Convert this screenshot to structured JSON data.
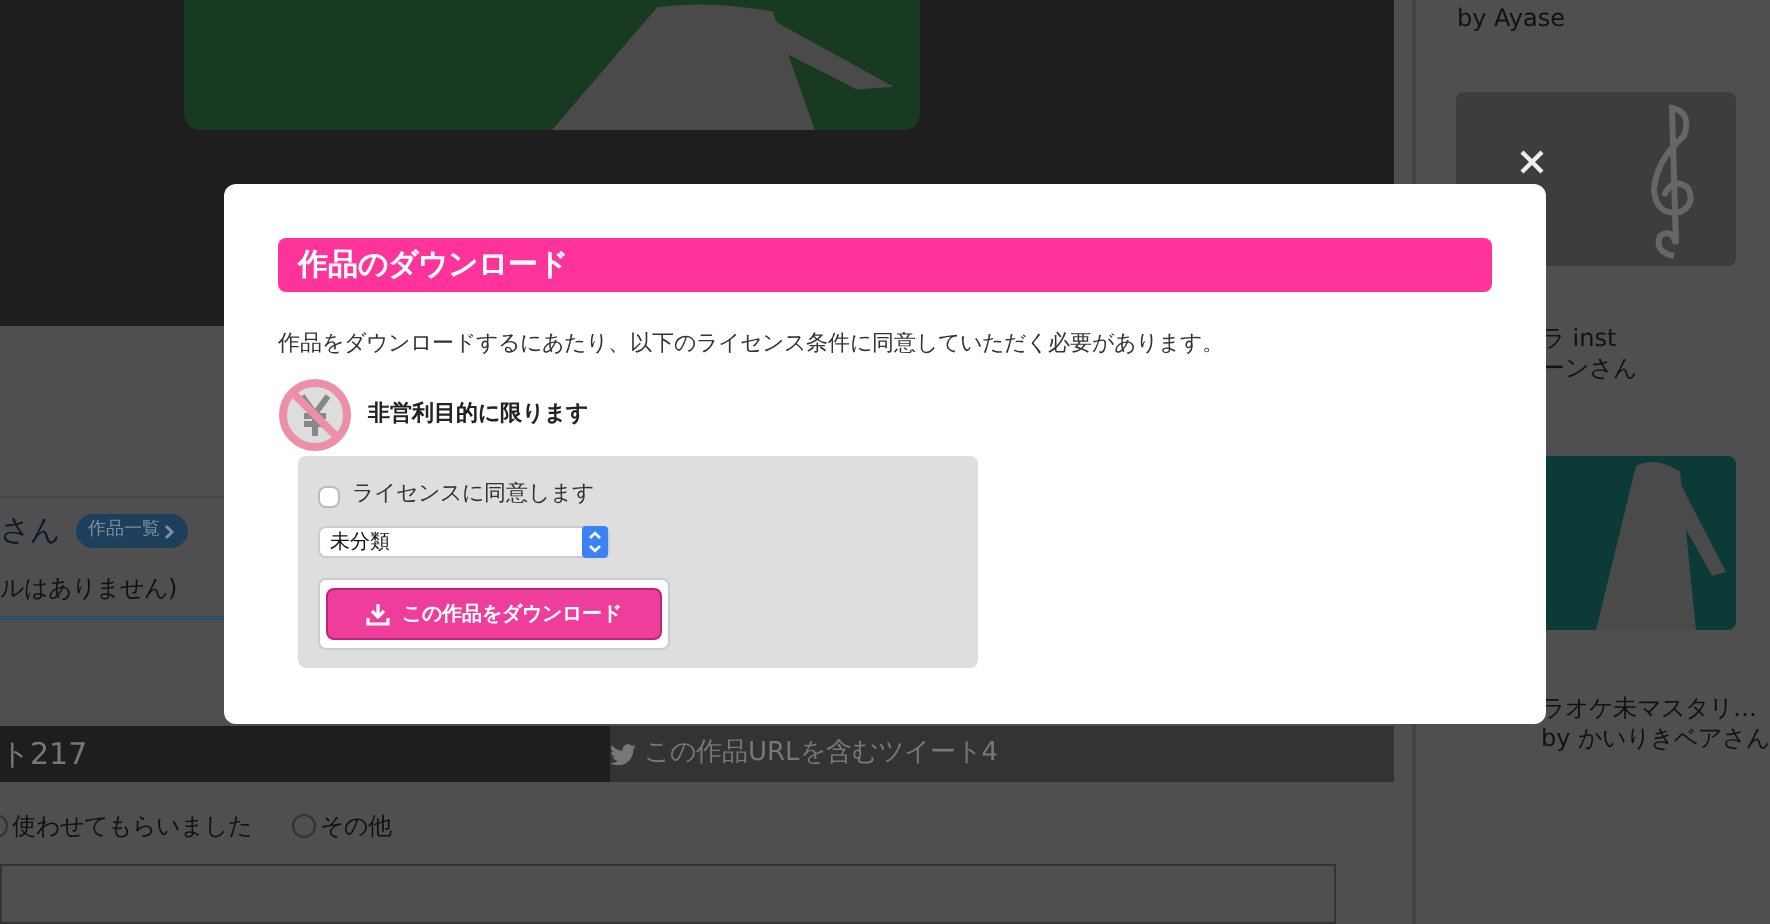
{
  "page": {
    "author_suffix": "さん",
    "works_badge": "作品一覧",
    "note": "ルはありません)",
    "share_bar": {
      "count_text": "ト217",
      "tweet_text": "この作品URLを含むツイート4"
    },
    "usage_options": [
      {
        "label": "使わせてもらいました",
        "selected": false
      },
      {
        "label": "その他",
        "selected": false
      }
    ]
  },
  "sidebar": {
    "top_caption": "by Ayase",
    "items": [
      {
        "kind": "clef",
        "title": "ラ inst",
        "author": "ーンさん"
      },
      {
        "kind": "picture",
        "title": "ラオケ未マスタリ…",
        "author": "by かいりきベアさん"
      }
    ]
  },
  "modal": {
    "title": "作品のダウンロード",
    "description": "作品をダウンロードするにあたり、以下のライセンス条件に同意していただく必要があります。",
    "license_label": "非営利目的に限ります",
    "agree": {
      "label": "ライセンスに同意します",
      "checked": false
    },
    "category": {
      "value": "未分類"
    },
    "download_button": "この作品をダウンロード"
  }
}
